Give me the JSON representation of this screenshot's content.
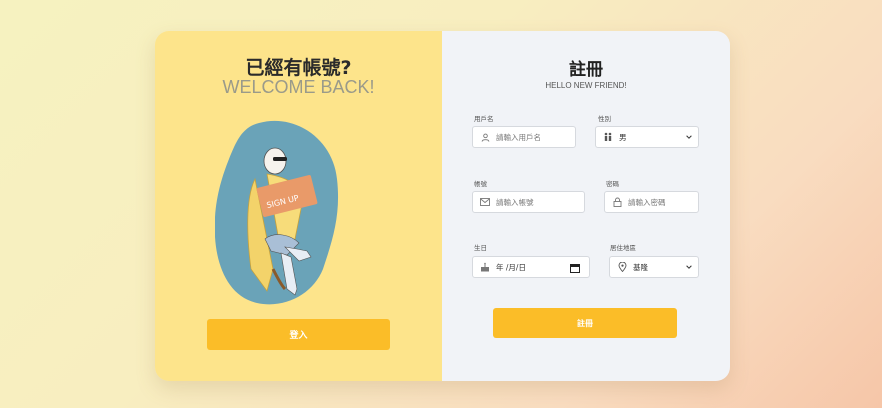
{
  "login_panel": {
    "title": "已經有帳號?",
    "subtitle": "WELCOME BACK!",
    "login_button": "登入",
    "illustration_sign_text": "SIGN UP"
  },
  "register_panel": {
    "title": "註冊",
    "subtitle": "HELLO NEW FRIEND!",
    "fields": {
      "username": {
        "label": "用戶名",
        "placeholder": "請輸入用戶名"
      },
      "gender": {
        "label": "性別",
        "value": "男"
      },
      "account": {
        "label": "帳號",
        "placeholder": "請輸入帳號"
      },
      "password": {
        "label": "密碼",
        "placeholder": "請輸入密碼"
      },
      "birthday": {
        "label": "生日",
        "value": "年 /月/日"
      },
      "region": {
        "label": "居住地區",
        "value": "基隆"
      }
    },
    "register_button": "註冊"
  },
  "colors": {
    "accent": "#fbbd28",
    "left_panel_bg": "#fde48b",
    "right_panel_bg": "#f1f3f7",
    "illustration_blob": "#6aa3b8"
  }
}
